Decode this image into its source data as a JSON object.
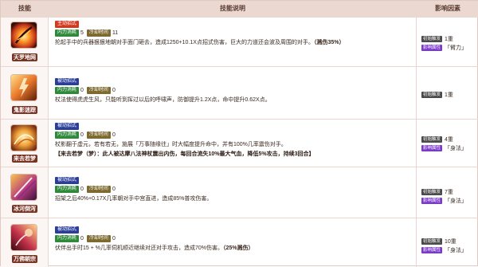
{
  "header": {
    "skill": "技能",
    "desc": "技能说明",
    "factor": "影响因素"
  },
  "labels": {
    "active_type": "主动招式",
    "passive_type": "被动招式",
    "internal": "内力消耗",
    "cost": "冷却时间",
    "factor_a": "初始触发",
    "factor_b": "影响属性"
  },
  "rows": [
    {
      "name": "天罗地网",
      "type_label": "主动招式",
      "internal": "5",
      "cost": "11",
      "desc": "抡起手中的兵器狠狠地朝对手面门砸去，造成1250+10.1X点招式伤害，巨大的力道还会波及周围的对手。",
      "desc_hl": "（溅伤35%）",
      "bonus": "",
      "factor_a": "1重",
      "factor_b": "「臂力」"
    },
    {
      "name": "鬼影迷踪",
      "type_label": "被动招式",
      "internal": "0",
      "cost": "0",
      "desc": "杖法使得虎虎生风，只能听到挥过以后的呼啸声，防御提升1.2X点，命中提升0.62X点。",
      "desc_hl": "",
      "bonus": "",
      "factor_a": "1重",
      "factor_b": ""
    },
    {
      "name": "来去若梦",
      "type_label": "被动招式",
      "internal": "0",
      "cost": "0",
      "desc": "杖影翻于虚元，若有若无，施展「万事随缘往」时大幅度提升命中，并有100%几率震伤对手。",
      "desc_hl": "",
      "bonus": "【来去若梦（梦）：此人被达摩八法神杖震出内伤，每回合流失10%最大气血，降低5%攻击，持续3回合】",
      "factor_a": "4重",
      "factor_b": "「身法」"
    },
    {
      "name": "冰河倒泻",
      "type_label": "被动招式",
      "internal": "0",
      "cost": "0",
      "desc": "招架之后40%+0.17X几率朝对手中宫直进，造成85%普攻伤害。",
      "desc_hl": "",
      "bonus": "",
      "factor_a": "7重",
      "factor_b": "「身法」"
    },
    {
      "name": "万佛朝宗",
      "type_label": "被动招式",
      "internal": "0",
      "cost": "0",
      "desc": "伏伴出手时15 + %几率伺机顺近继续对还对手攻击，造成70%伤害。",
      "desc_hl": "（25%溅伤）",
      "bonus": "",
      "factor_a": "10重",
      "factor_b": "「身法」"
    }
  ],
  "colors": {
    "header_bg": "#ead8d1",
    "active_tag": "#d6381f",
    "passive_tag": "#2b3f9a",
    "internal_tag": "#2e8a3a",
    "cost_tag": "#7d6a2e",
    "factor_gray": "#4a4a4a",
    "factor_purple": "#7a3bc9"
  }
}
